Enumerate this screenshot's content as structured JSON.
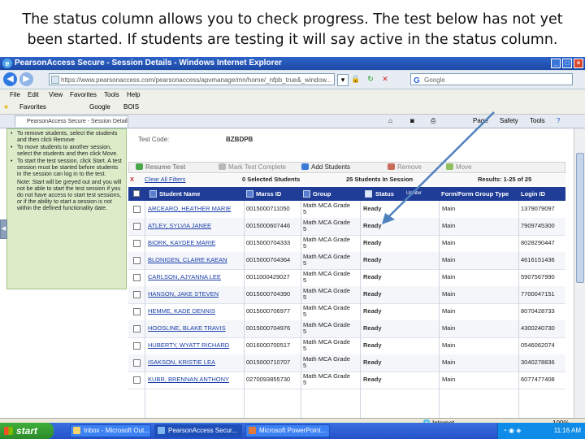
{
  "caption": {
    "line1": "The status column allows you to check progress.  The test below has not yet",
    "line2": "been started.  If students are testing it will say active in the status column."
  },
  "window": {
    "title": "PearsonAccess Secure - Session Details - Windows Internet Explorer",
    "address": "https://www.pearsonaccess.com/pearsonaccess/apvmanage/mn/home/_nfpb_true&_window...",
    "search_placeholder": "Google",
    "menu": [
      "File",
      "Edit",
      "View",
      "Favorites",
      "Tools",
      "Help"
    ],
    "favorites": [
      "Favorites",
      "Google",
      "BOIS"
    ],
    "tab_title": "PearsonAccess Secure - Session Details",
    "tools": [
      "Page",
      "Safety",
      "Tools"
    ]
  },
  "left_panel": {
    "items": [
      "To remove students, select the students and then click Remove",
      "To move students to another session, select the students and then click Move.",
      "To start the test session, click Start. A test session must be started before students in the session can log in to the test."
    ],
    "note": "Note: Start will be greyed out and you will not be able to start the test session if you do not have access to start test sessions, or if the ability to start a session is not within the defined functionality date."
  },
  "test_code": {
    "label": "Test Code:",
    "value": "BZBDPB"
  },
  "actions": [
    "Resume Test",
    "Mark Test Complete",
    "Add Students",
    "Remove",
    "Move"
  ],
  "filters": {
    "clear": "Clear All Filters",
    "selected": "0 Selected Students",
    "count": "25 Students In Session",
    "results": "Results: 1-25 of 25"
  },
  "table": {
    "headers": [
      "Student Name",
      "Marss ID",
      "Group",
      "Status",
      "Form/Form Group Type",
      "Login ID"
    ],
    "status_filter_label": "Unfilter",
    "rows": [
      {
        "name": "ARCEARO, HEATHER MARIE",
        "id": "0015000711050",
        "group": "Math MCA Grade 5",
        "status": "Ready",
        "form": "Main",
        "login": "1379079097"
      },
      {
        "name": "ATLEY, SYLVIA JANEE",
        "id": "0015000607446",
        "group": "Math MCA Grade 5",
        "status": "Ready",
        "form": "Main",
        "login": "7909745300"
      },
      {
        "name": "BIORK, KAYDEE MARIE",
        "id": "0015000704333",
        "group": "Math MCA Grade 5",
        "status": "Ready",
        "form": "Main",
        "login": "8028290447"
      },
      {
        "name": "BLONIGEN, CLAIRE KAEAN",
        "id": "0015000704364",
        "group": "Math MCA Grade 5",
        "status": "Ready",
        "form": "Main",
        "login": "4616151436"
      },
      {
        "name": "CARLSON, AJYANNA LEE",
        "id": "0011000429027",
        "group": "Math MCA Grade 5",
        "status": "Ready",
        "form": "Main",
        "login": "5907567990"
      },
      {
        "name": "HANSON, JAKE STEVEN",
        "id": "0015000704390",
        "group": "Math MCA Grade 5",
        "status": "Ready",
        "form": "Main",
        "login": "7700047151"
      },
      {
        "name": "HEMME, KADE DENNIS",
        "id": "0015000706977",
        "group": "Math MCA Grade 5",
        "status": "Ready",
        "form": "Main",
        "login": "8070428733"
      },
      {
        "name": "HOOSLINE, BLAKE TRAVIS",
        "id": "0015000704976",
        "group": "Math MCA Grade 5",
        "status": "Ready",
        "form": "Main",
        "login": "4300240730"
      },
      {
        "name": "HUBERTY, WYATT RICHARD",
        "id": "0016000700517",
        "group": "Math MCA Grade 5",
        "status": "Ready",
        "form": "Main",
        "login": "0546062074"
      },
      {
        "name": "ISAKSON, KRISTIE LEA",
        "id": "0015000710707",
        "group": "Math MCA Grade 5",
        "status": "Ready",
        "form": "Main",
        "login": "3040278836"
      },
      {
        "name": "KUBR, BRENNAN ANTHONY",
        "id": "0270093855730",
        "group": "Math MCA Grade 5",
        "status": "Ready",
        "form": "Main",
        "login": "6077477408"
      }
    ]
  },
  "statusbar": {
    "zone": "Internet",
    "zoom": "100%"
  },
  "taskbar": {
    "start": "start",
    "tasks": [
      "Inbox - Microsoft Out...",
      "PearsonAccess Secur...",
      "Microsoft PowerPoint..."
    ],
    "time": "11:16 AM"
  }
}
